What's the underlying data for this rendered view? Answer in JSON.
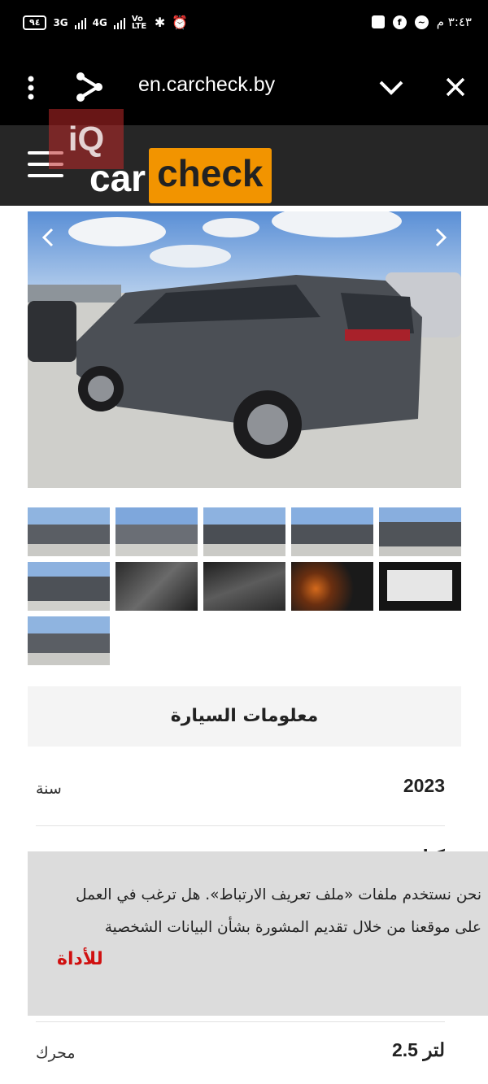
{
  "status_bar": {
    "battery": "٩٤",
    "network_1": "3G",
    "network_2": "4G",
    "volte": "Vo LTE",
    "time": "٣:٤٣ م"
  },
  "browser": {
    "url": "en.carcheck.by",
    "menu_icon": "more-vert-icon",
    "share_icon": "share-icon",
    "collapse_icon": "chevron-down-icon",
    "close_icon": "close-icon"
  },
  "site_header": {
    "logo_part_1": "car",
    "logo_part_2": "check",
    "logo_accent": "#f29400",
    "watermark": "iQ"
  },
  "gallery": {
    "prev_icon": "chevron-left-icon",
    "next_icon": "chevron-right-icon",
    "thumbnail_count": 11
  },
  "car_info": {
    "heading": "معلومات السيارة",
    "rows": [
      {
        "label": "سنة",
        "value": "2023"
      },
      {
        "label": "محرك",
        "value": "لتر 2.5"
      }
    ],
    "partial_peek": "كيا"
  },
  "cookie_banner": {
    "message": "نحن نستخدم ملفات «ملف تعريف الارتباط». هل ترغب في العمل على موقعنا من خلال تقديم المشورة بشأن البيانات الشخصية",
    "link_text": "للأداة",
    "link_color": "#d01010"
  }
}
